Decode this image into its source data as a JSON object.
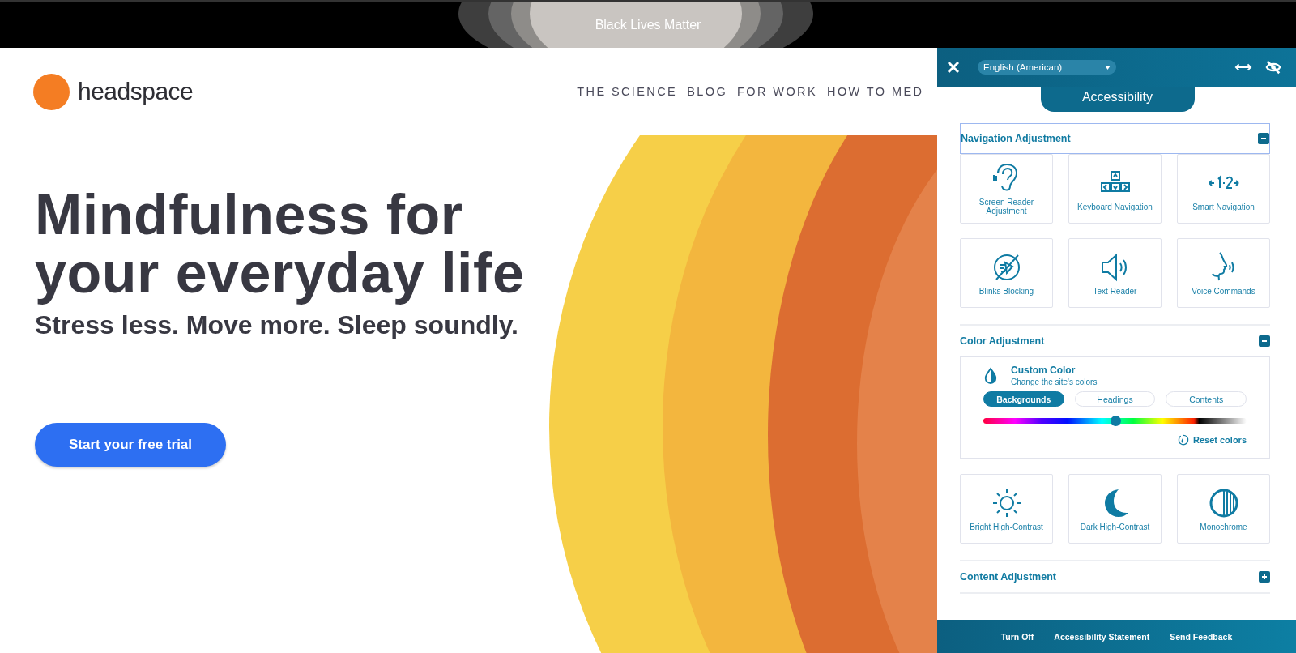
{
  "banner": {
    "text": "Black Lives Matter"
  },
  "site": {
    "logo": "headspace",
    "nav": [
      "THE SCIENCE",
      "BLOG",
      "FOR WORK",
      "HOW TO MED"
    ],
    "hero": {
      "title_lines": [
        "Mindfulness for",
        "your everyday life"
      ],
      "subtitle": "Stress less. Move more. Sleep soundly.",
      "cta": "Start your free trial",
      "art": {
        "kind": "picture"
      }
    }
  },
  "panel": {
    "language": "English (American)",
    "title": "Accessibility",
    "sections": [
      {
        "title": "Navigation Adjustment",
        "expanded": true,
        "focused": true,
        "blocks": [
          {
            "kind": "tiles",
            "tiles": [
              {
                "label": "Screen Reader Adjustment"
              },
              {
                "label": "Keyboard Navigation"
              },
              {
                "label": "Smart Navigation"
              },
              {
                "label": "Blinks Blocking"
              },
              {
                "label": "Text Reader"
              },
              {
                "label": "Voice Commands"
              }
            ]
          }
        ]
      },
      {
        "title": "Color Adjustment",
        "expanded": true,
        "focused": false,
        "blocks": [
          {
            "kind": "custom_color",
            "title": "Custom Color",
            "subtitle": "Change the site's colors",
            "targets": [
              {
                "label": "Backgrounds",
                "selected": true
              },
              {
                "label": "Headings",
                "selected": false
              },
              {
                "label": "Contents",
                "selected": false
              }
            ],
            "level": 0.5,
            "reset": "Reset colors"
          },
          {
            "kind": "tiles",
            "tiles": [
              {
                "label": "Bright High-Contrast"
              },
              {
                "label": "Dark High-Contrast"
              },
              {
                "label": "Monochrome"
              }
            ]
          }
        ]
      },
      {
        "title": "Content Adjustment",
        "expanded": false,
        "focused": false
      }
    ],
    "footer": [
      "Turn Off",
      "Accessibility Statement",
      "Send Feedback"
    ]
  }
}
